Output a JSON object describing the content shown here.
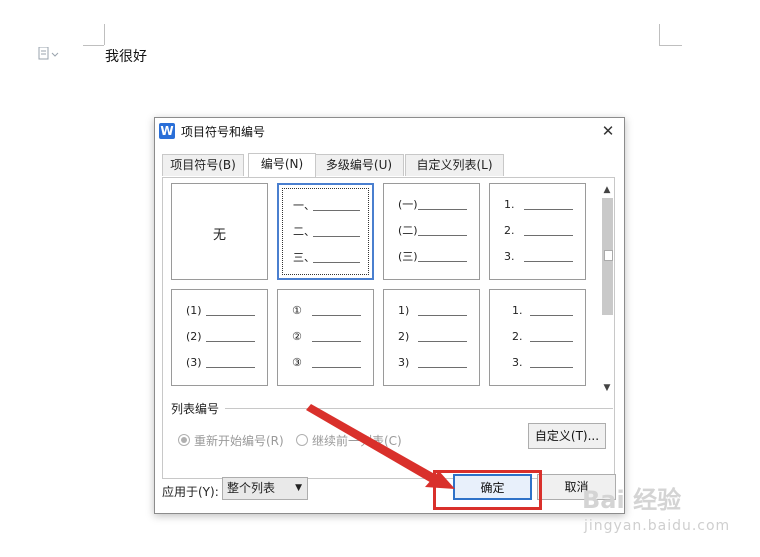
{
  "document": {
    "text": "我很好"
  },
  "dialog": {
    "title": "项目符号和编号",
    "tabs": [
      {
        "label": "项目符号(B)",
        "active": false
      },
      {
        "label": "编号(N)",
        "active": true
      },
      {
        "label": "多级编号(U)",
        "active": false
      },
      {
        "label": "自定义列表(L)",
        "active": false
      }
    ],
    "none_label": "无",
    "styles": [
      {
        "markers": [
          "一、",
          "二、",
          "三、"
        ],
        "selected": true
      },
      {
        "markers": [
          "(一)",
          "(二)",
          "(三)"
        ],
        "selected": false
      },
      {
        "markers": [
          "1.",
          "2.",
          "3."
        ],
        "selected": false
      },
      {
        "markers": [
          "(1)",
          "(2)",
          "(3)"
        ],
        "selected": false
      },
      {
        "markers": [
          "①",
          "②",
          "③"
        ],
        "selected": false
      },
      {
        "markers": [
          "1)",
          "2)",
          "3)"
        ],
        "selected": false
      },
      {
        "markers": [
          "1.",
          "2.",
          "3."
        ],
        "selected": false
      }
    ],
    "list_numbering_label": "列表编号",
    "radio_restart": "重新开始编号(R)",
    "radio_continue": "继续前一列表(C)",
    "custom_button": "自定义(T)...",
    "apply_to_label": "应用于(Y):",
    "apply_to_value": "整个列表",
    "ok_button": "确定",
    "cancel_button": "取消"
  },
  "watermark": {
    "logo": "Bai 经验",
    "url": "jingyan.baidu.com"
  },
  "colors": {
    "annotation": "#d9302b",
    "accent": "#2f72c8"
  }
}
